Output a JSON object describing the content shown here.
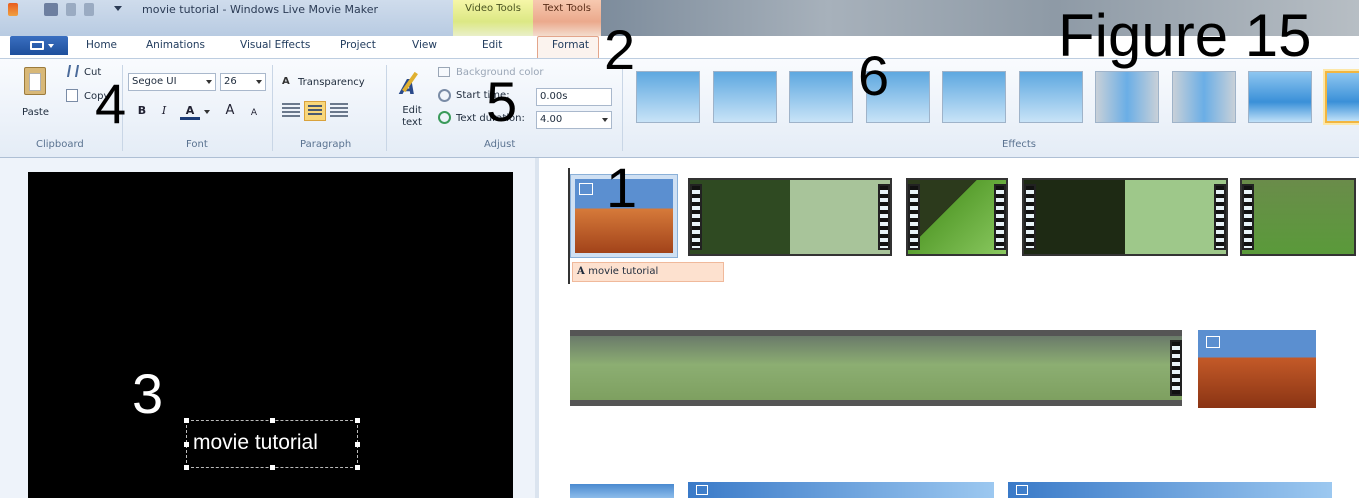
{
  "window": {
    "title": "movie tutorial - Windows Live Movie Maker",
    "contextual_tabs": [
      "Video Tools",
      "Text Tools"
    ]
  },
  "tabs": [
    {
      "label": "Home"
    },
    {
      "label": "Animations"
    },
    {
      "label": "Visual Effects"
    },
    {
      "label": "Project"
    },
    {
      "label": "View"
    },
    {
      "label": "Edit"
    },
    {
      "label": "Format",
      "selected": true
    }
  ],
  "ribbon": {
    "clipboard": {
      "paste": "Paste",
      "cut": "Cut",
      "copy": "Copy",
      "label": "Clipboard"
    },
    "font": {
      "family": "Segoe UI",
      "size": "26",
      "bold": "B",
      "italic": "I",
      "color": "A",
      "grow": "A",
      "shrink": "A",
      "label": "Font"
    },
    "paragraph": {
      "transparency": "Transparency",
      "label": "Paragraph"
    },
    "adjust": {
      "edit_text": "Edit text",
      "background_color": "Background color",
      "start_time_label": "Start time:",
      "start_time_value": "0.00s",
      "text_duration_label": "Text duration:",
      "text_duration_value": "4.00",
      "label": "Adjust"
    },
    "effects": {
      "label": "Effects",
      "count": 10,
      "selected_index": 9
    }
  },
  "annotations": {
    "figure": "Figure 15",
    "n1": "1",
    "n2": "2",
    "n3": "3",
    "n4": "4",
    "n5": "5",
    "n6": "6"
  },
  "preview": {
    "caption": "movie tutorial"
  },
  "storyboard": {
    "text_clip_label": "movie tutorial"
  },
  "colors": {
    "ribbon_bg": "#e4ecf6",
    "format_tab_accent": "#e3a58b",
    "video_tools": "#dce884",
    "text_tools": "#eba98c",
    "effect_selected": "#f2b640"
  }
}
